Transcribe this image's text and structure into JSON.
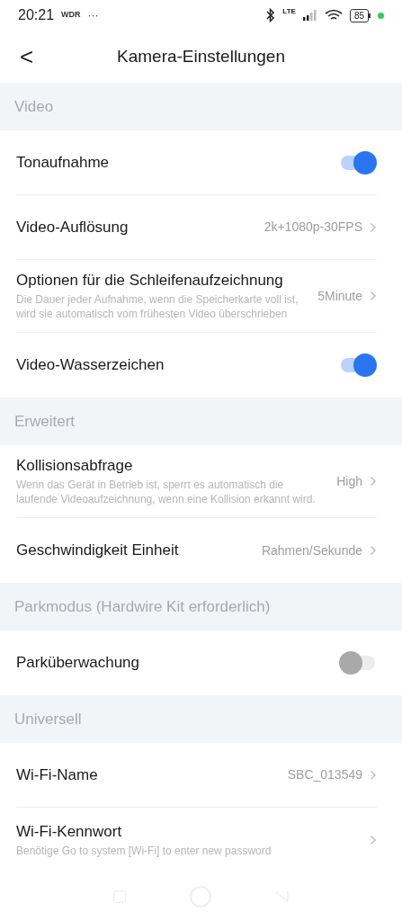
{
  "status_bar": {
    "time": "20:21",
    "carrier": "WDR",
    "more": "···",
    "network": "LTE",
    "battery": "85"
  },
  "header": {
    "back": "<",
    "title": "Kamera-Einstellungen"
  },
  "sections": [
    {
      "title": "Video",
      "rows": [
        {
          "kind": "toggle",
          "label": "Tonaufnahme",
          "on": true
        },
        {
          "kind": "value",
          "label": "Video-Auflösung",
          "value": "2k+1080p-30FPS"
        },
        {
          "kind": "value",
          "label": "Optionen für die Schleifenaufzeichnung",
          "description": "Die Dauer jeder Aufnahme, wenn die Speicherkarte voll ist, wird sie automatisch vom frühesten Video überschrieben",
          "value": "5Minute"
        },
        {
          "kind": "toggle",
          "label": "Video-Wasserzeichen",
          "on": true
        }
      ]
    },
    {
      "title": "Erweitert",
      "rows": [
        {
          "kind": "value",
          "label": "Kollisionsabfrage",
          "description": "Wenn das Gerät in Betrieb ist, sperrt es automatisch die laufende Videoaufzeichnung, wenn eine Kollision erkannt wird.",
          "value": "High"
        },
        {
          "kind": "value",
          "label": "Geschwindigkeit Einheit",
          "value": "Rahmen/Sekunde"
        }
      ]
    },
    {
      "title": "Parkmodus (Hardwire Kit erforderlich)",
      "rows": [
        {
          "kind": "toggle",
          "label": "Parküberwachung",
          "on": false
        }
      ]
    },
    {
      "title": "Universell",
      "rows": [
        {
          "kind": "value",
          "label": "Wi-Fi-Name",
          "value": "SBC_013549"
        },
        {
          "kind": "value",
          "label": "Wi-Fi-Kennwort",
          "description": "Benötige Go to system [Wi-Fi] to enter new password"
        }
      ]
    }
  ]
}
